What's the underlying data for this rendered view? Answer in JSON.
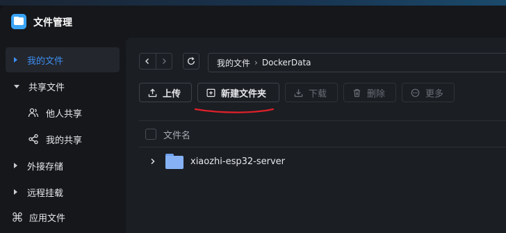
{
  "app": {
    "title": "文件管理"
  },
  "sidebar": {
    "items": [
      {
        "label": "我的文件"
      },
      {
        "label": "共享文件"
      },
      {
        "label": "他人共享"
      },
      {
        "label": "我的共享"
      },
      {
        "label": "外接存储"
      },
      {
        "label": "远程挂载"
      },
      {
        "label": "应用文件"
      }
    ]
  },
  "breadcrumb": {
    "root": "我的文件",
    "separator": "›",
    "current": "DockerData"
  },
  "toolbar": {
    "upload": "上传",
    "new_folder": "新建文件夹",
    "download": "下载",
    "delete": "删除",
    "more": "更多"
  },
  "table": {
    "header_name": "文件名"
  },
  "files": [
    {
      "name": "xiaozhi-esp32-server",
      "type": "folder"
    }
  ],
  "colors": {
    "accent": "#3d8ef2",
    "annotation": "#e0202a"
  }
}
